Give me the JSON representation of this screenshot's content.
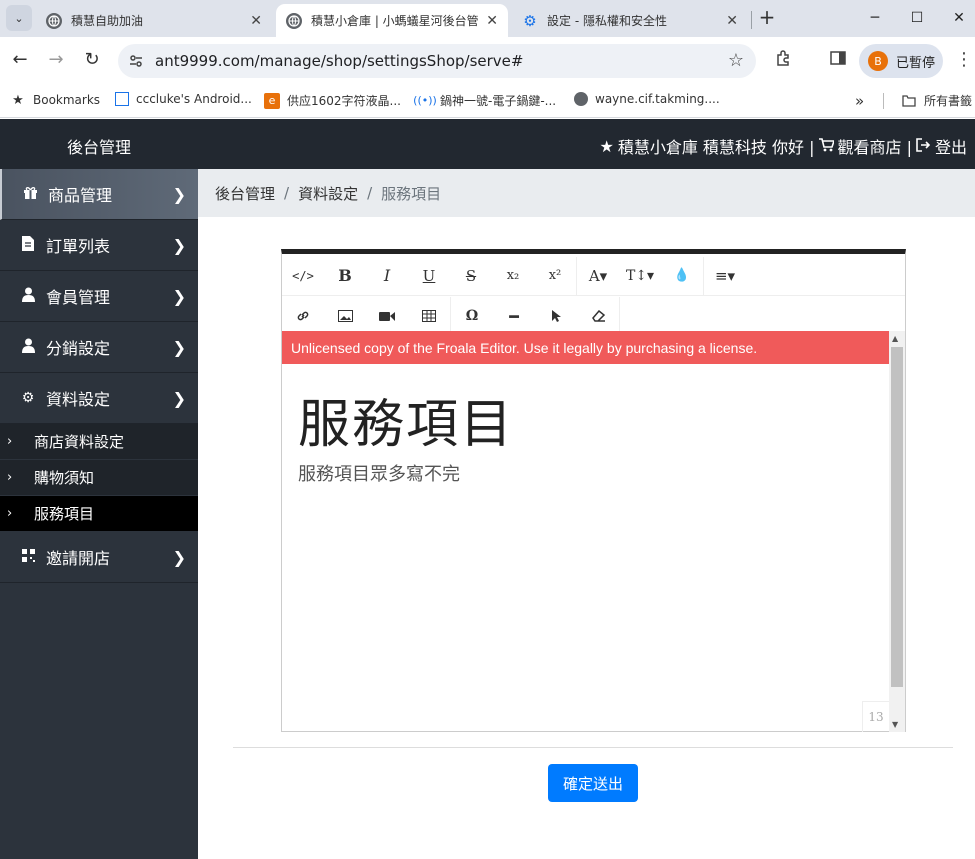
{
  "browser": {
    "tabs": [
      {
        "title": "積慧自助加油",
        "active": false
      },
      {
        "title": "積慧小倉庫 | 小螞蟻星河後台管",
        "active": true
      },
      {
        "title": "設定 - 隱私權和安全性",
        "active": false
      }
    ],
    "new_tab": "+",
    "url": "ant9999.com/manage/shop/settingsShop/serve#",
    "profile_initial": "B",
    "profile_label": "已暫停",
    "bookmarks": [
      {
        "label": "Bookmarks",
        "icon": "star-icon"
      },
      {
        "label": "cccluke's Android...",
        "icon": "page-icon"
      },
      {
        "label": "供应1602字符液晶...",
        "icon": "shop-icon"
      },
      {
        "label": "鍋神一號-電子鍋鍵-...",
        "icon": "wifi-icon"
      },
      {
        "label": "wayne.cif.takming....",
        "icon": "globe-icon"
      }
    ],
    "bookmarks_overflow": "»",
    "all_bookmarks": "所有書籤"
  },
  "app": {
    "title": "後台管理",
    "header_shop": "積慧小倉庫 積慧科技 你好 |",
    "header_view_shop": "觀看商店 |",
    "header_logout": "登出"
  },
  "sidebar": {
    "items": [
      {
        "label": "商品管理",
        "icon": "gift-icon"
      },
      {
        "label": "訂單列表",
        "icon": "file-icon"
      },
      {
        "label": "會員管理",
        "icon": "user-icon"
      },
      {
        "label": "分銷設定",
        "icon": "user-icon"
      },
      {
        "label": "資料設定",
        "icon": "gear-icon"
      }
    ],
    "subitems": [
      {
        "label": "商店資料設定"
      },
      {
        "label": "購物須知"
      },
      {
        "label": "服務項目"
      }
    ],
    "last_item": {
      "label": "邀請開店",
      "icon": "qrcode-icon"
    }
  },
  "breadcrumb": [
    "後台管理",
    "資料設定",
    "服務項目"
  ],
  "editor": {
    "warning": "Unlicensed copy of the Froala Editor. Use it legally by purchasing a license.",
    "heading": "服務項目",
    "paragraph": "服務項目眾多寫不完",
    "char_count": "13"
  },
  "submit_label": "確定送出",
  "colors": {
    "header_bg": "#222830",
    "sidebar_bg": "#2c333c",
    "warning_bg": "#f05a5a",
    "primary": "#007bff"
  }
}
